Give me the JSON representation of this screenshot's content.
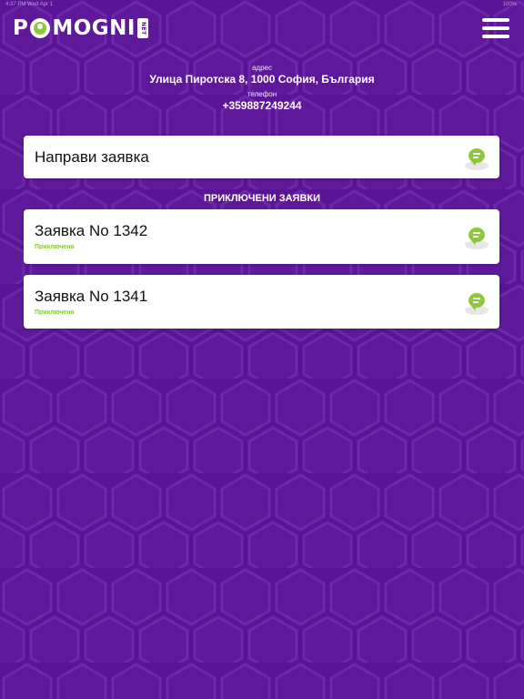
{
  "status_bar": {
    "left": "4:37 PM  Wed Apr 1",
    "right": "100%"
  },
  "header": {
    "logo_text_1": "P",
    "logo_text_2": "MOGNI",
    "logo_badge": "NET"
  },
  "contact": {
    "address_label": "адрес",
    "address": "Улица Пиротска 8, 1000 София, България",
    "phone_label": "телефон",
    "phone": "+359887249244"
  },
  "new_request": {
    "label": "Направи заявка"
  },
  "completed_section": {
    "heading": "ПРИКЛЮЧЕНИ ЗАЯВКИ",
    "requests": [
      {
        "title": "Заявка No 1342",
        "status": "Приключена"
      },
      {
        "title": "Заявка No 1341",
        "status": "Приключена"
      }
    ]
  },
  "colors": {
    "background": "#5a1596",
    "hex_line": "#6a25a8",
    "accent": "#8dc63f",
    "card": "#ffffff"
  },
  "icons": {
    "menu": "hamburger-icon",
    "chat": "chat-bubble-icon"
  }
}
